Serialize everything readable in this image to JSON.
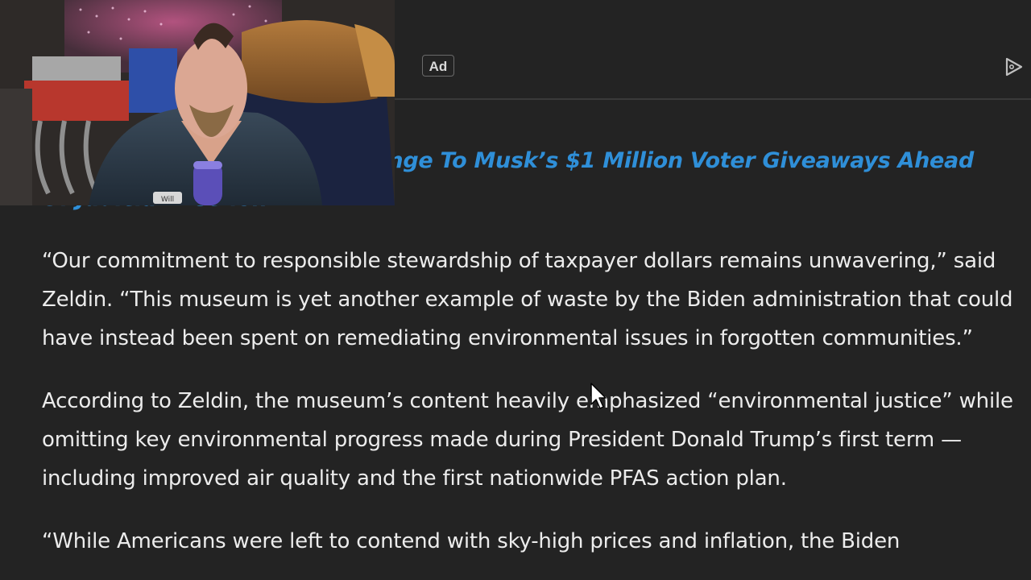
{
  "ad": {
    "badge_label": "Ad",
    "choices_icon": "adchoices-play-icon"
  },
  "headline": {
    "text": "Appeals Court Rejects Challenge To Musk’s $1 Million Voter Giveaways Ahead Of Judicial Election"
  },
  "article": {
    "paragraphs": [
      "“Our commitment to responsible stewardship of taxpayer dollars remains unwavering,” said Zeldin. “This museum is yet another example of waste by the Biden administration that could have instead been spent on remediating environmental issues in forgotten communities.”",
      "According to Zeldin, the museum’s content heavily emphasized “environmental justice” while omitting key environmental progress made during President Donald Trump’s first term — including improved air quality and the first nationwide PFAS action plan.",
      "“While Americans were left to contend with sky-high prices and inflation, the Biden"
    ]
  },
  "webcam": {
    "mic_label": "Will"
  },
  "colors": {
    "background": "#232323",
    "text": "#ececec",
    "link": "#2f8fd8",
    "divider": "#3a3a3a"
  }
}
